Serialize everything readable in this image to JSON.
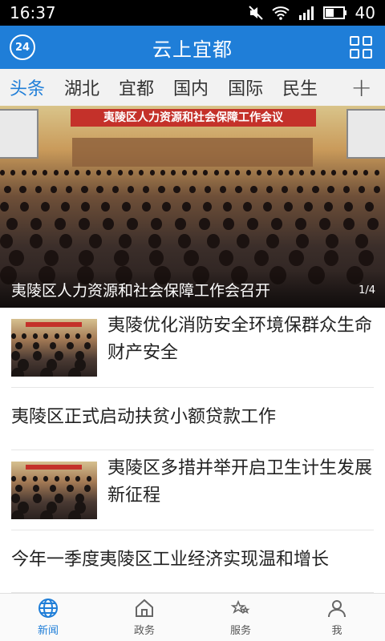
{
  "status": {
    "time": "16:37",
    "battery": "40",
    "network": "3G"
  },
  "header": {
    "title": "云上宜都",
    "weather_temp": "24"
  },
  "tabs": [
    {
      "label": "头条",
      "active": true
    },
    {
      "label": "湖北"
    },
    {
      "label": "宜都"
    },
    {
      "label": "国内"
    },
    {
      "label": "国际"
    },
    {
      "label": "民生"
    }
  ],
  "tab_add": "+",
  "hero": {
    "banner": "夷陵区人力资源和社会保障工作会议",
    "caption": "夷陵区人力资源和社会保障工作会召开",
    "counter": "1/4"
  },
  "news": [
    {
      "headline": "夷陵优化消防安全环境保群众生命财产安全",
      "has_image": true
    },
    {
      "headline": "夷陵区正式启动扶贫小额贷款工作",
      "has_image": false
    },
    {
      "headline": "夷陵区多措并举开启卫生计生发展新征程",
      "has_image": true
    },
    {
      "headline": "今年一季度夷陵区工业经济实现温和增长",
      "has_image": false
    }
  ],
  "bottom_nav": [
    {
      "label": "新闻",
      "icon": "globe-icon",
      "active": true
    },
    {
      "label": "政务",
      "icon": "home-icon"
    },
    {
      "label": "服务",
      "icon": "stars-icon"
    },
    {
      "label": "我",
      "icon": "person-icon"
    }
  ],
  "colors": {
    "accent": "#1f7ed8",
    "banner": "#c4312a"
  }
}
